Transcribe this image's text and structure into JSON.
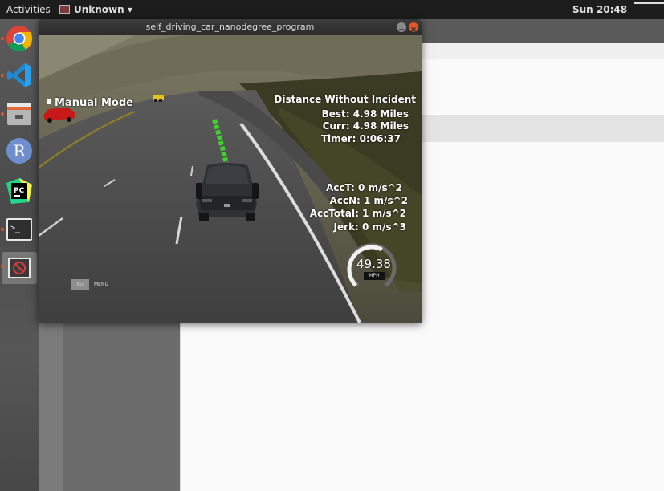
{
  "topbar": {
    "activities": "Activities",
    "app_menu": "Unknown ▾",
    "clock": "Sun 20:48"
  },
  "dock": {
    "items": [
      {
        "name": "chrome-icon",
        "running": true
      },
      {
        "name": "vscode-icon",
        "running": true
      },
      {
        "name": "files-icon",
        "running": true
      },
      {
        "name": "r-icon",
        "running": false
      },
      {
        "name": "pycharm-icon",
        "running": false
      },
      {
        "name": "terminal-icon",
        "running": true
      },
      {
        "name": "simulator-icon",
        "running": true
      }
    ]
  },
  "simulator": {
    "window_title": "self_driving_car_nanodegree_program",
    "mode_label": "Manual Mode",
    "distance_title": "Distance Without Incident",
    "best": "Best: 4.98 Miles",
    "curr": "Curr: 4.98 Miles",
    "timer": "Timer: 0:06:37",
    "acc_t": "AccT: 0 m/s^2",
    "acc_n": "AccN: 1 m/s^2",
    "acc_total": "AccTotal: 1 m/s^2",
    "jerk": "Jerk: 0 m/s^3",
    "speed": "49.38",
    "speed_unit": "MPH",
    "speed_fraction": 0.6,
    "menu_label": "MENU",
    "esc_label": "Esc"
  },
  "colors": {
    "path": "#3fd12e",
    "ubuntu_orange": "#e95420",
    "topbar": "#1d1d1d"
  }
}
